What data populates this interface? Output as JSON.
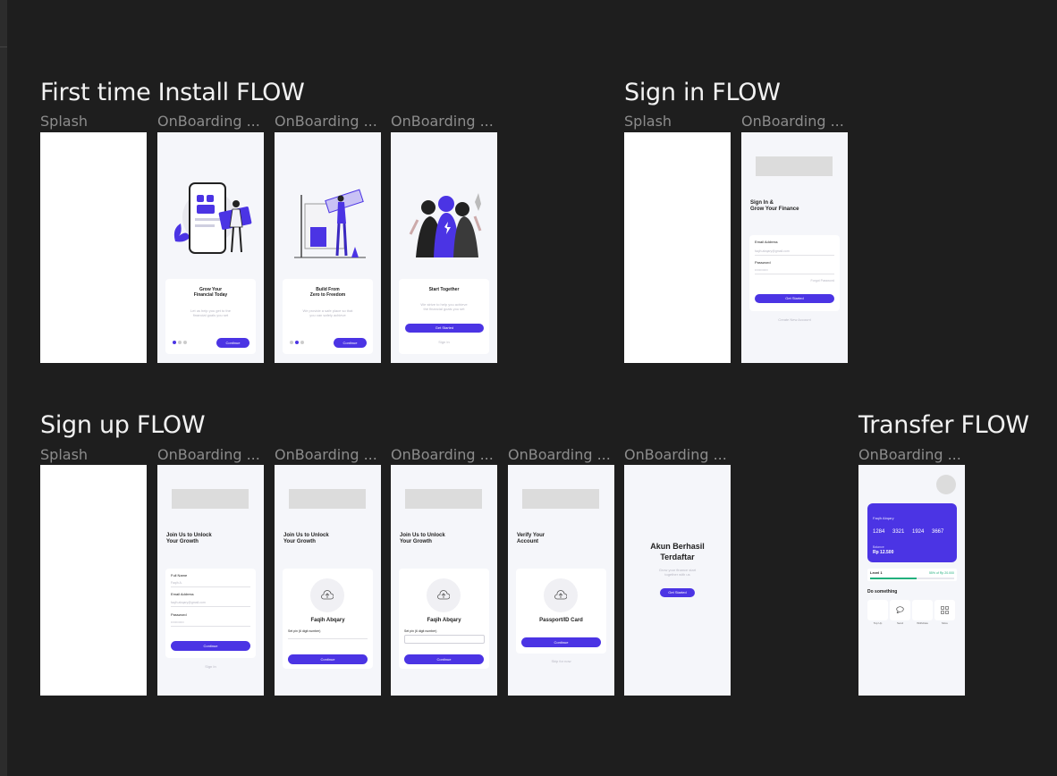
{
  "sections": {
    "install": {
      "title": "First time Install FLOW",
      "labels": [
        "Splash",
        "OnBoarding ...",
        "OnBoarding ...",
        "OnBoarding ..."
      ],
      "ob1": {
        "title": "Grow Your\nFinancial Today",
        "desc": "Let us help you get to the\nfinancial goals you set",
        "button": "Continue"
      },
      "ob2": {
        "title": "Build From\nZero to Freedom",
        "desc": "We provide a safe place so that\nyou can safely achieve",
        "button": "Continue"
      },
      "ob3": {
        "title": "Start Together",
        "desc": "We strive to help you achieve\nthe financial goals you set",
        "button": "Get Started",
        "link": "Sign In"
      }
    },
    "signin": {
      "title": "Sign in FLOW",
      "labels": [
        "Splash",
        "OnBoarding ..."
      ],
      "screen": {
        "title": "Sign In &\nGrow Your Finance",
        "email_label": "Email Address",
        "email_value": "faqih.abqary@gmail.com",
        "password_label": "Password",
        "password_value": "••••••••••••",
        "forgot": "Forgot Password",
        "button": "Get Started",
        "create": "Create New Account"
      }
    },
    "signup": {
      "title": "Sign up FLOW",
      "labels": [
        "Splash",
        "OnBoarding ...",
        "OnBoarding ...",
        "OnBoarding ...",
        "OnBoarding ...",
        "OnBoarding ..."
      ],
      "form": {
        "title": "Join Us to Unlock\nYour Growth",
        "name_label": "Full Name",
        "name_value": "Faqih A.",
        "email_label": "Email Address",
        "email_value": "faqih.abqary@gmail.com",
        "password_label": "Password",
        "password_value": "••••••••••••",
        "button": "Continue",
        "link": "Sign In"
      },
      "pin1": {
        "title": "Join Us to Unlock\nYour Growth",
        "name": "Faqih Abqary",
        "pin_label": "Set pin (6 digit number)",
        "button": "Continue"
      },
      "pin2": {
        "title": "Join Us to Unlock\nYour Growth",
        "name": "Faqih Abqary",
        "pin_label": "Set pin (6 digit number)",
        "button": "Continue"
      },
      "verify": {
        "title": "Verify Your\nAccount",
        "card_label": "Passport/ID Card",
        "button": "Continue",
        "skip": "Skip for now"
      },
      "success": {
        "title": "Akun Berhasil\nTerdaftar",
        "desc": "Grow your finance start\ntogether with us",
        "button": "Get Started"
      }
    },
    "transfer": {
      "title": "Transfer FLOW",
      "labels": [
        "OnBoarding ..."
      ],
      "screen": {
        "card_name": "Faqih Abqary",
        "card_number": [
          "1284",
          "3321",
          "1924",
          "3667"
        ],
        "balance_label": "Balance",
        "balance": "Rp 12.500",
        "level": "Level 1",
        "level_progress": "55% of Rp 20.000",
        "level_fill": 0.55,
        "do_something": "Do something",
        "actions": [
          "Top Up",
          "Send",
          "Withdraw",
          "More"
        ]
      }
    }
  },
  "colors": {
    "accent": "#4b34e4",
    "canvas": "#1e1e1e",
    "screen_bg": "#f5f6fa"
  }
}
